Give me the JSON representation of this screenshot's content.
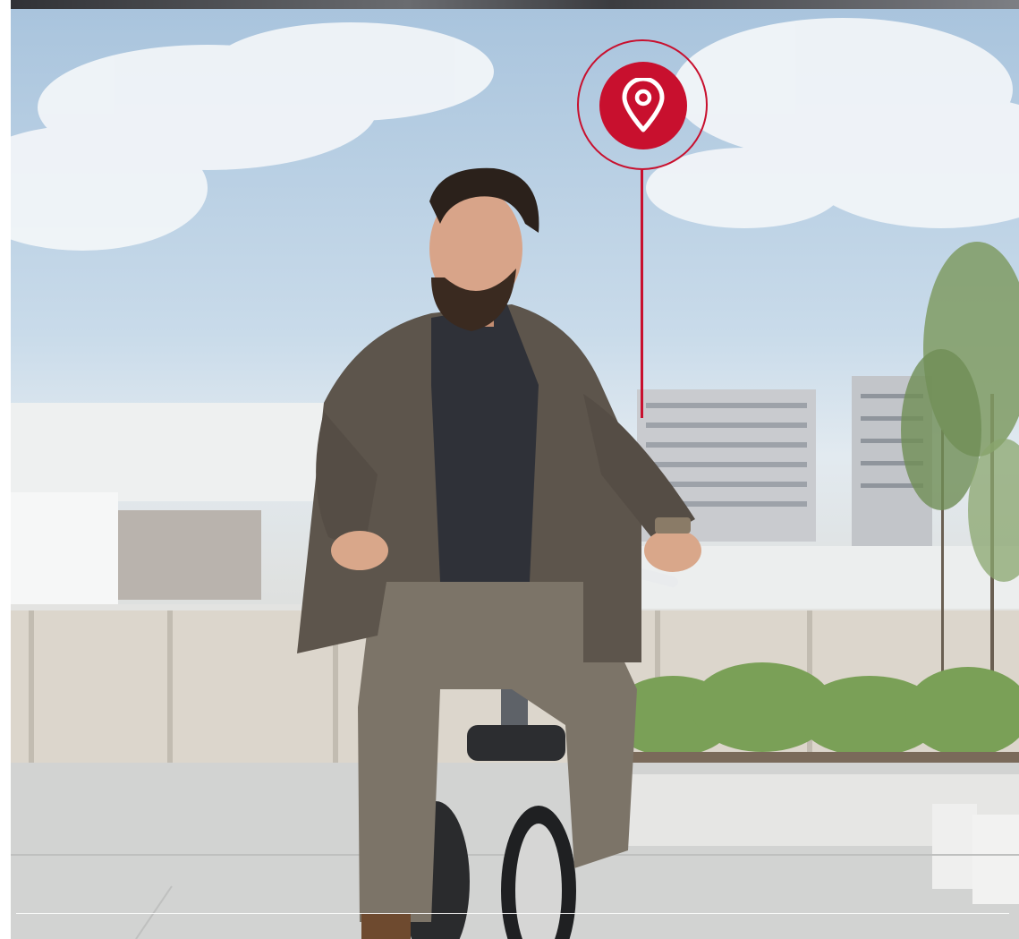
{
  "colors": {
    "accent_red": "#c8102e",
    "sky": "#a9c4dd",
    "jacket": "#5d554c",
    "trousers": "#7c7468",
    "shirt": "#2f3138",
    "foliage": "#7f9b63"
  },
  "scene": {
    "subject": "man-on-bicycle",
    "marker_icon": "location-pin-icon"
  }
}
